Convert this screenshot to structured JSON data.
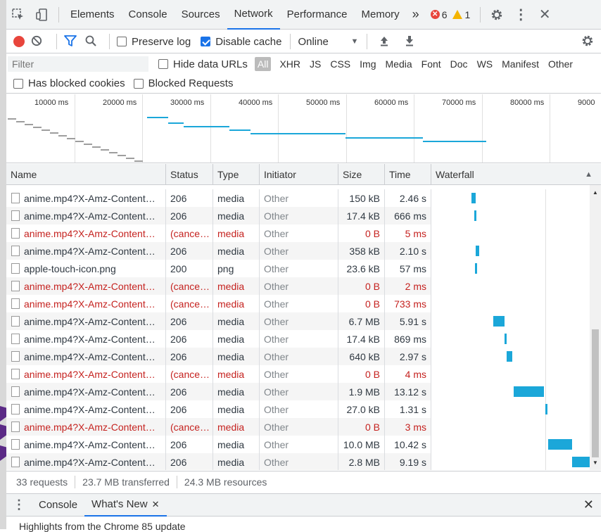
{
  "tabbar": {
    "tabs": [
      {
        "label": "Elements"
      },
      {
        "label": "Console"
      },
      {
        "label": "Sources"
      },
      {
        "label": "Network",
        "active": true
      },
      {
        "label": "Performance"
      },
      {
        "label": "Memory"
      }
    ],
    "more": "»",
    "error_count": "6",
    "warning_count": "1"
  },
  "toolbar": {
    "preserve_log": "Preserve log",
    "preserve_log_checked": false,
    "disable_cache": "Disable cache",
    "disable_cache_checked": true,
    "throttling": "Online"
  },
  "filter": {
    "placeholder": "Filter",
    "hide_data_urls": "Hide data URLs",
    "types": [
      "All",
      "XHR",
      "JS",
      "CSS",
      "Img",
      "Media",
      "Font",
      "Doc",
      "WS",
      "Manifest",
      "Other"
    ],
    "has_blocked_cookies": "Has blocked cookies",
    "blocked_requests": "Blocked Requests"
  },
  "overview": {
    "ticks": [
      "10000 ms",
      "20000 ms",
      "30000 ms",
      "40000 ms",
      "50000 ms",
      "60000 ms",
      "70000 ms",
      "80000 ms",
      "9000"
    ]
  },
  "table": {
    "columns": [
      "Name",
      "Status",
      "Type",
      "Initiator",
      "Size",
      "Time",
      "Waterfall"
    ],
    "rows": [
      {
        "name": "anime.mp4?X-Amz-Content…",
        "status": "206",
        "type": "media",
        "initiator": "Other",
        "size": "150 kB",
        "time": "2.46 s",
        "failed": false,
        "wf_start": 0.234,
        "wf_len": 0.025
      },
      {
        "name": "anime.mp4?X-Amz-Content…",
        "status": "206",
        "type": "media",
        "initiator": "Other",
        "size": "17.4 kB",
        "time": "666 ms",
        "failed": false,
        "wf_start": 0.25,
        "wf_len": 0.01
      },
      {
        "name": "anime.mp4?X-Amz-Content…",
        "status": "(cance…",
        "type": "media",
        "initiator": "Other",
        "size": "0 B",
        "time": "5 ms",
        "failed": true
      },
      {
        "name": "anime.mp4?X-Amz-Content…",
        "status": "206",
        "type": "media",
        "initiator": "Other",
        "size": "358 kB",
        "time": "2.10 s",
        "failed": false,
        "wf_start": 0.26,
        "wf_len": 0.02
      },
      {
        "name": "apple-touch-icon.png",
        "status": "200",
        "type": "png",
        "initiator": "Other",
        "size": "23.6 kB",
        "time": "57 ms",
        "failed": false,
        "wf_start": 0.255,
        "wf_len": 0.008
      },
      {
        "name": "anime.mp4?X-Amz-Content…",
        "status": "(cance…",
        "type": "media",
        "initiator": "Other",
        "size": "0 B",
        "time": "2 ms",
        "failed": true
      },
      {
        "name": "anime.mp4?X-Amz-Content…",
        "status": "(cance…",
        "type": "media",
        "initiator": "Other",
        "size": "0 B",
        "time": "733 ms",
        "failed": true
      },
      {
        "name": "anime.mp4?X-Amz-Content…",
        "status": "206",
        "type": "media",
        "initiator": "Other",
        "size": "6.7 MB",
        "time": "5.91 s",
        "failed": false,
        "wf_start": 0.37,
        "wf_len": 0.07
      },
      {
        "name": "anime.mp4?X-Amz-Content…",
        "status": "206",
        "type": "media",
        "initiator": "Other",
        "size": "17.4 kB",
        "time": "869 ms",
        "failed": false,
        "wf_start": 0.44,
        "wf_len": 0.012
      },
      {
        "name": "anime.mp4?X-Amz-Content…",
        "status": "206",
        "type": "media",
        "initiator": "Other",
        "size": "640 kB",
        "time": "2.97 s",
        "failed": false,
        "wf_start": 0.455,
        "wf_len": 0.035
      },
      {
        "name": "anime.mp4?X-Amz-Content…",
        "status": "(cance…",
        "type": "media",
        "initiator": "Other",
        "size": "0 B",
        "time": "4 ms",
        "failed": true
      },
      {
        "name": "anime.mp4?X-Amz-Content…",
        "status": "206",
        "type": "media",
        "initiator": "Other",
        "size": "1.9 MB",
        "time": "13.12 s",
        "failed": false,
        "wf_start": 0.5,
        "wf_len": 0.19
      },
      {
        "name": "anime.mp4?X-Amz-Content…",
        "status": "206",
        "type": "media",
        "initiator": "Other",
        "size": "27.0 kB",
        "time": "1.31 s",
        "failed": false,
        "wf_start": 0.7,
        "wf_len": 0.015
      },
      {
        "name": "anime.mp4?X-Amz-Content…",
        "status": "(cance…",
        "type": "media",
        "initiator": "Other",
        "size": "0 B",
        "time": "3 ms",
        "failed": true
      },
      {
        "name": "anime.mp4?X-Amz-Content…",
        "status": "206",
        "type": "media",
        "initiator": "Other",
        "size": "10.0 MB",
        "time": "10.42 s",
        "failed": false,
        "wf_start": 0.72,
        "wf_len": 0.15
      },
      {
        "name": "anime.mp4?X-Amz-Content…",
        "status": "206",
        "type": "media",
        "initiator": "Other",
        "size": "2.8 MB",
        "time": "9.19 s",
        "failed": false,
        "wf_start": 0.87,
        "wf_len": 0.13
      }
    ]
  },
  "status": {
    "requests": "33 requests",
    "transferred": "23.7 MB transferred",
    "resources": "24.3 MB resources"
  },
  "drawer": {
    "tabs": [
      {
        "label": "Console"
      },
      {
        "label": "What's New",
        "active": true
      }
    ],
    "content": "Highlights from the Chrome 85 update"
  },
  "colors": {
    "accent": "#1a73e8",
    "waterfall": "#1ba7d9",
    "error": "#c5221f",
    "record": "#e8453c"
  }
}
